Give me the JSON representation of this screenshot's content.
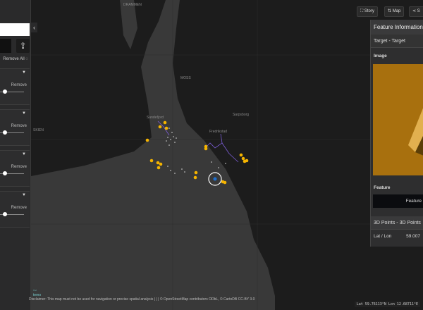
{
  "map": {
    "place_labels": [
      "DRAMMEN",
      "MOSS",
      "SKIEN",
      "Sarpsborg",
      "Fredrikstad",
      "Sandefjord"
    ],
    "marker_color": "#f5b400",
    "target_color": "#1e6fd0",
    "track_color": "#7b5cd6",
    "coords": "Lat 59.76113°N  Lon 12.68711°E",
    "disclaimer": "Disclaimer: This map must not be used for navigation or precise spatial analysis |        |        | © OpenStreetMap contributors ODbL, © CartoDB CC-BY 3.0",
    "logo": "temo"
  },
  "sidebar": {
    "remove_all": "Remove All",
    "groups": [
      {
        "remove": "Remove",
        "opacity": 0.15
      },
      {
        "remove": "Remove",
        "opacity": 0.15
      },
      {
        "remove": "Remove",
        "opacity": 0.15
      },
      {
        "remove": "Remove",
        "opacity": 0.15
      }
    ]
  },
  "toolbar": {
    "story": "Story",
    "map": "Map",
    "share": "S"
  },
  "panel": {
    "title": "Feature Information",
    "target": "Target - Target",
    "image_label": "Image",
    "feature_label": "Feature",
    "feature_button": "Feature",
    "points": "3D Points - 3D Points",
    "latlon_label": "Lat / Lon",
    "latlon_value": "59.007"
  }
}
